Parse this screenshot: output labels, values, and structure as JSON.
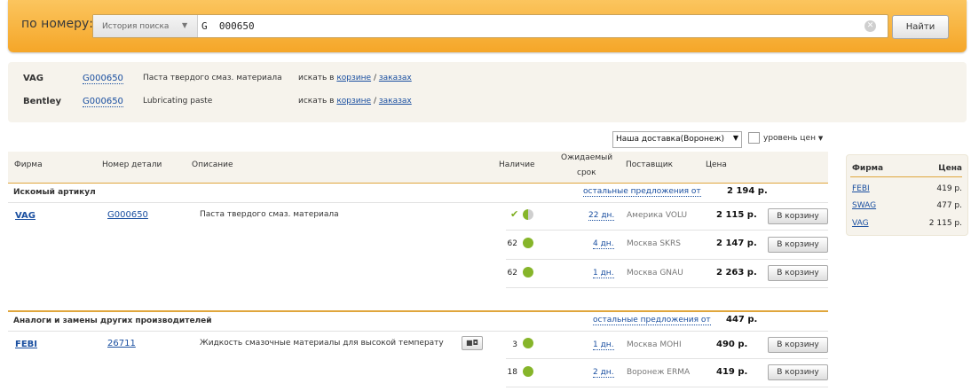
{
  "search": {
    "label": "по номеру:",
    "history_label": "История поиска",
    "query": "G  000650",
    "find_button": "Найти"
  },
  "found": [
    {
      "brand": "VAG",
      "number": "G000650",
      "description": "Паста твердого смаз. материала",
      "search_in": "искать в",
      "cart_link": "корзине",
      "sep": "/",
      "orders_link": "заказах"
    },
    {
      "brand": "Bentley",
      "number": "G000650",
      "description": "Lubricating paste",
      "search_in": "искать в",
      "cart_link": "корзине",
      "sep": "/",
      "orders_link": "заказах"
    }
  ],
  "delivery": {
    "selected": "Наша доставка(Воронеж)",
    "price_level_label": "уровень цен"
  },
  "table": {
    "headers": {
      "brand": "Фирма",
      "number": "Номер детали",
      "description": "Описание",
      "availability": "Наличие",
      "expected_1": "Ожидаемый",
      "expected_2": "срок",
      "supplier": "Поставщик",
      "price": "Цена"
    },
    "cart_button": "В корзину",
    "sections": [
      {
        "title": "Искомый артикул",
        "other_offers": "остальные предложения от",
        "best_price": "2 194 р.",
        "brand": "VAG",
        "number": "G000650",
        "description": "Паста твердого смаз. материала",
        "offers": [
          {
            "qty": "",
            "days": "22 дн.",
            "supplier": "Америка VOLU",
            "price": "2 115 р."
          },
          {
            "qty": "62",
            "days": "4 дн.",
            "supplier": "Москва SKRS",
            "price": "2 147 р."
          },
          {
            "qty": "62",
            "days": "1 дн.",
            "supplier": "Москва GNAU",
            "price": "2 263 р."
          }
        ]
      },
      {
        "title": "Аналоги и замены других производителей",
        "other_offers": "остальные предложения от",
        "best_price": "447 р.",
        "brand": "FEBI",
        "number": "26711",
        "description": "Жидкость смазочные материалы для высокой температу",
        "offers": [
          {
            "qty": "3",
            "days": "1 дн.",
            "supplier": "Москва MOHI",
            "price": "490 р."
          },
          {
            "qty": "18",
            "days": "2 дн.",
            "supplier": "Воронеж ERMA",
            "price": "419 р."
          }
        ]
      }
    ]
  },
  "side_panel": {
    "header_brand": "Фирма",
    "header_price": "Цена",
    "rows": [
      {
        "brand": "FEBI",
        "price": "419 р."
      },
      {
        "brand": "SWAG",
        "price": "477 р."
      },
      {
        "brand": "VAG",
        "price": "2 115 р."
      }
    ]
  },
  "colors": {
    "accent_orange": "#f5a628",
    "link_blue": "#1a4fa0",
    "panel_beige": "#f6f3ec",
    "stock_green": "#86b52a"
  }
}
